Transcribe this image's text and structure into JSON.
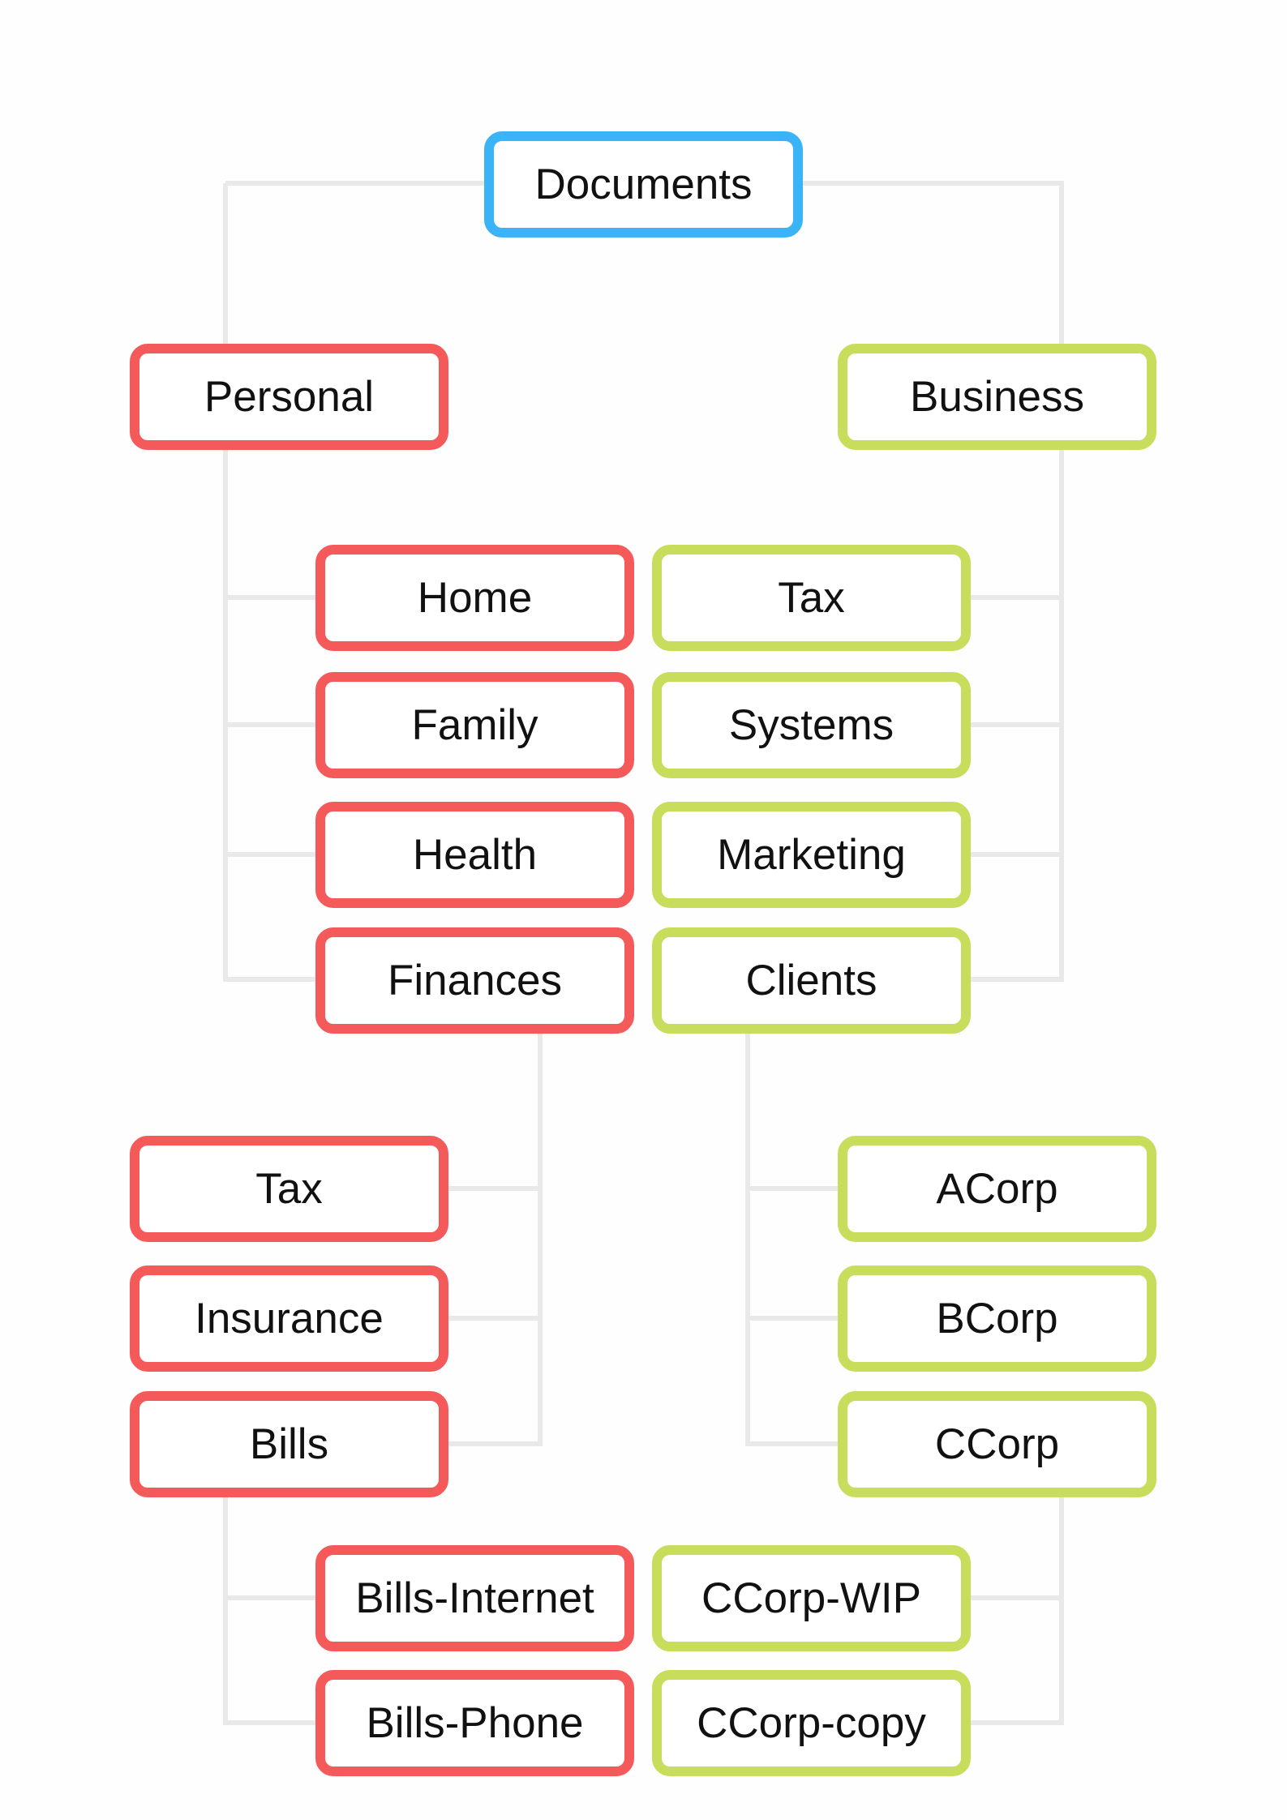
{
  "colors": {
    "root": "#3bb4f7",
    "personal": "#f55a5a",
    "business": "#c9dd5c",
    "connector": "#e9e9e9"
  },
  "root": "Documents",
  "personal": {
    "label": "Personal",
    "children": [
      "Home",
      "Family",
      "Health",
      "Finances"
    ],
    "finances_children": [
      "Tax",
      "Insurance",
      "Bills"
    ],
    "bills_children": [
      "Bills-Internet",
      "Bills-Phone"
    ]
  },
  "business": {
    "label": "Business",
    "children": [
      "Tax",
      "Systems",
      "Marketing",
      "Clients"
    ],
    "clients_children": [
      "ACorp",
      "BCorp",
      "CCorp"
    ],
    "ccorp_children": [
      "CCorp-WIP",
      "CCorp-copy"
    ]
  }
}
